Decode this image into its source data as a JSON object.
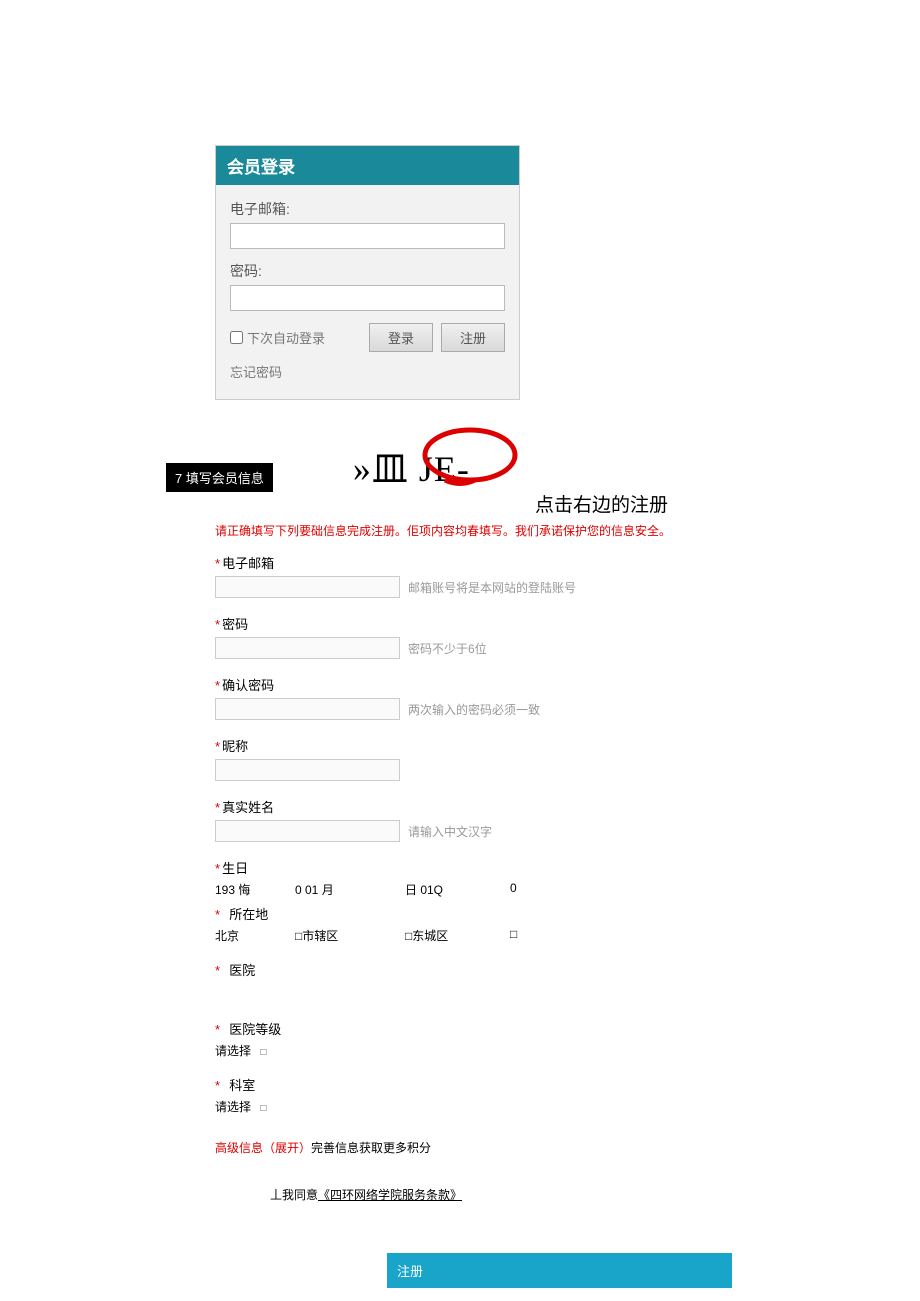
{
  "login": {
    "header": "会员登录",
    "email_label": "电子邮箱:",
    "password_label": "密码:",
    "auto_login": "下次自动登录",
    "login_btn": "登录",
    "register_btn": "注册",
    "forgot": "忘记密码"
  },
  "instruction_right": "点击右边的注册",
  "step_badge": "7 填写会员信息",
  "step_title": "»皿 JE-",
  "reg": {
    "notice": "请正确填写下列要础信息完成注册。佢项内容均春填写。我们承诺保护您的信息安全。",
    "email": {
      "label": "电子邮箱",
      "hint": "邮箱账号将是本网站的登陆账号"
    },
    "password": {
      "label": "密码",
      "hint": "密码不少于6位"
    },
    "confirm": {
      "label": "确认密码",
      "hint": "两次输入的密码必须一致"
    },
    "nickname": {
      "label": "昵称"
    },
    "realname": {
      "label": "真实姓名",
      "hint": "请输入中文汉字"
    },
    "birthday": {
      "label": "生日",
      "year": "193 悔",
      "month": "0 01 月",
      "day": "日 01Q",
      "q": "0"
    },
    "location": {
      "label": "所在地",
      "province": "北京",
      "city_marker": "□市辖区",
      "district_marker": "□东城区",
      "tail": "□"
    },
    "hospital": {
      "label": "医院"
    },
    "hospital_level": {
      "label": "医院等级",
      "select": "请选择",
      "marker": "□"
    },
    "department": {
      "label": "科室",
      "select": "请选择",
      "marker": "□"
    },
    "advanced": {
      "link": "高级信息（展开）",
      "rest": "完善信息获取更多积分"
    },
    "agree": {
      "prefix": "丄我同意",
      "terms": "《四环网络学院服务条款》"
    },
    "submit": "注册"
  }
}
